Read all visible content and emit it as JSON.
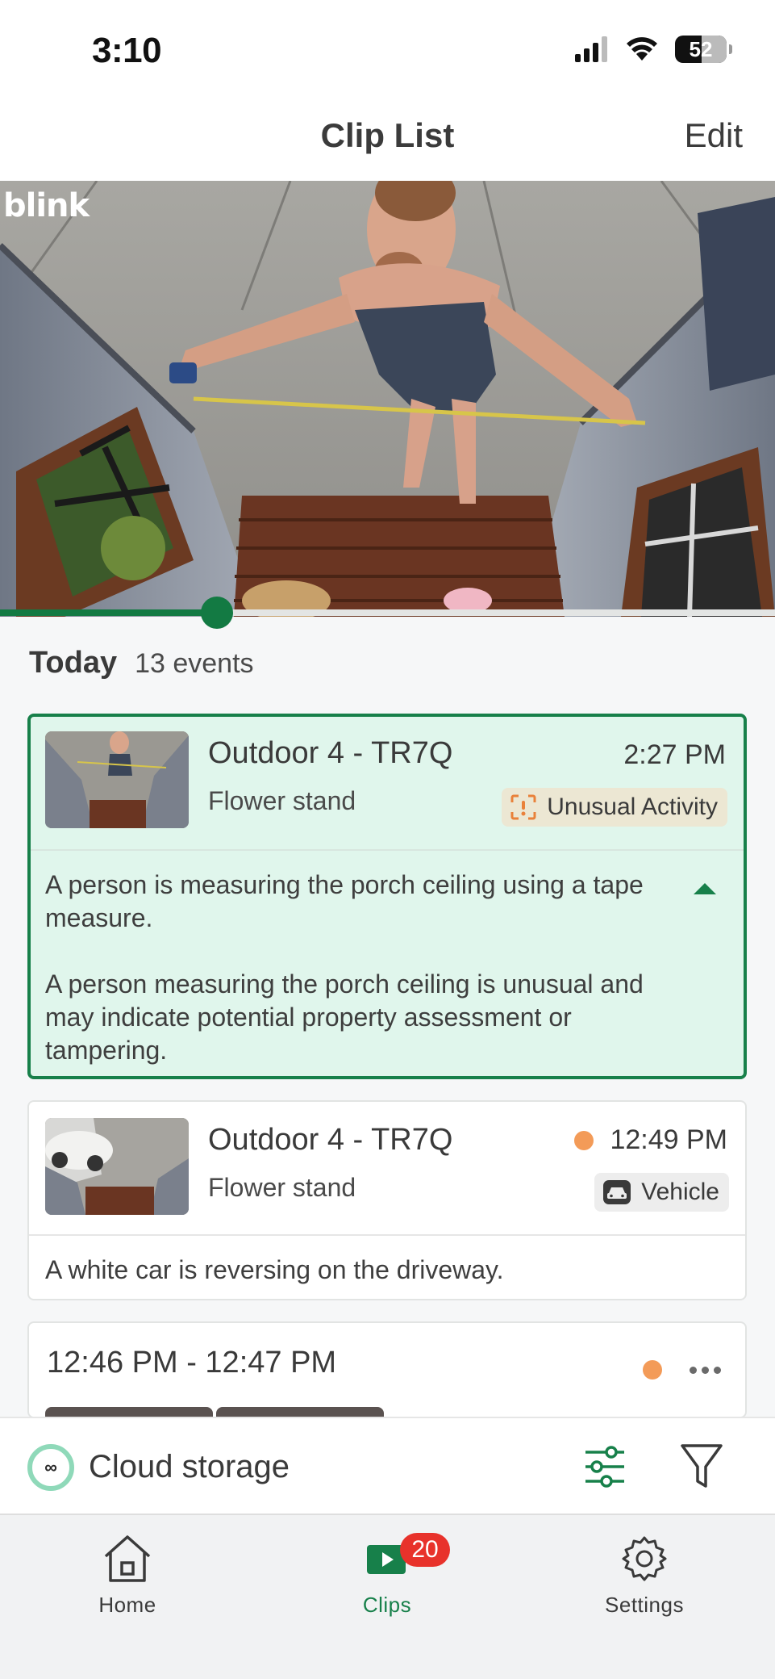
{
  "status_bar": {
    "time": "3:10",
    "battery_level": "52",
    "icons": [
      "cellular-signal-icon",
      "wifi-icon",
      "battery-icon"
    ]
  },
  "header": {
    "title": "Clip List",
    "edit_label": "Edit"
  },
  "video": {
    "logo": "blink",
    "progress_fraction": 0.28
  },
  "events_header": {
    "day": "Today",
    "count": "13 events"
  },
  "events": [
    {
      "camera": "Outdoor 4 - TR7Q",
      "location": "Flower stand",
      "time": "2:27 PM",
      "tag": "Unusual Activity",
      "tag_icon": "unusual-activity-icon",
      "selected": true,
      "description": "A person is measuring the porch ceiling using a tape measure.",
      "insight": "A person measuring the porch ceiling is unusual and may indicate potential property assessment or tampering."
    },
    {
      "camera": "Outdoor 4 - TR7Q",
      "location": "Flower stand",
      "time": "12:49 PM",
      "tag": "Vehicle",
      "tag_icon": "car-icon",
      "unwatched": true,
      "description": "A white car is reversing on the driveway."
    }
  ],
  "event_group": {
    "time_range": "12:46 PM - 12:47 PM",
    "unwatched": true
  },
  "cloud_bar": {
    "label": "Cloud storage",
    "icon_symbol": "∞"
  },
  "tab_bar": {
    "tabs": [
      {
        "label": "Home",
        "icon": "home-icon"
      },
      {
        "label": "Clips",
        "icon": "clips-icon",
        "badge": "20",
        "active": true
      },
      {
        "label": "Settings",
        "icon": "gear-icon"
      }
    ]
  },
  "colors": {
    "accent": "#17804a",
    "selected_card_bg": "#e0f6ec",
    "unwatched_dot": "#f39b58",
    "badge": "#e8322b"
  }
}
